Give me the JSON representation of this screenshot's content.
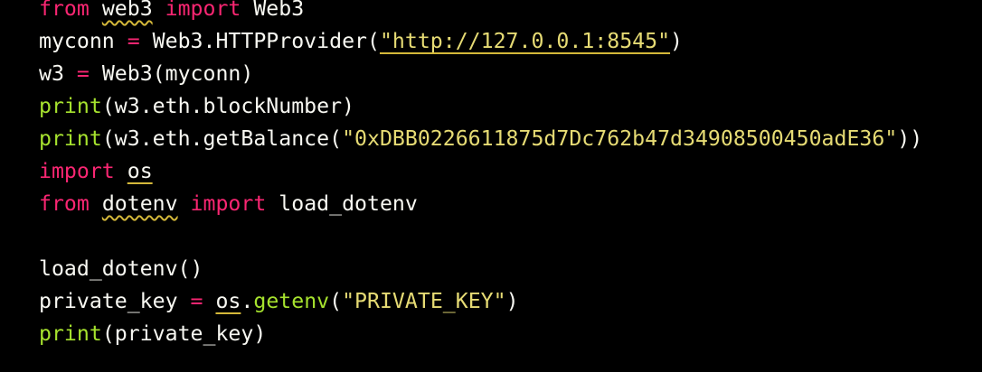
{
  "colors": {
    "background": "#000000",
    "default_text": "#f8f8f2",
    "keyword": "#f92672",
    "builtin_function": "#a6e22e",
    "string": "#e6db74",
    "lint_underline": "#d4b83a"
  },
  "code": {
    "lines": [
      {
        "tokens": [
          {
            "text": "from",
            "type": "keyword"
          },
          {
            "text": " ",
            "type": "plain"
          },
          {
            "text": "web3",
            "type": "plain",
            "underline": "wavy"
          },
          {
            "text": " ",
            "type": "plain"
          },
          {
            "text": "import",
            "type": "keyword"
          },
          {
            "text": " Web3",
            "type": "plain"
          }
        ]
      },
      {
        "tokens": [
          {
            "text": "myconn ",
            "type": "plain"
          },
          {
            "text": "=",
            "type": "keyword"
          },
          {
            "text": " Web3.HTTPProvider(",
            "type": "plain"
          },
          {
            "text": "\"http://127.0.0.1:8545\"",
            "type": "string",
            "underline": "solid"
          },
          {
            "text": ")",
            "type": "plain"
          }
        ]
      },
      {
        "tokens": [
          {
            "text": "w3 ",
            "type": "plain"
          },
          {
            "text": "=",
            "type": "keyword"
          },
          {
            "text": " Web3(myconn)",
            "type": "plain"
          }
        ]
      },
      {
        "tokens": [
          {
            "text": "print",
            "type": "builtin"
          },
          {
            "text": "(w3.eth.blockNumber)",
            "type": "plain"
          }
        ]
      },
      {
        "tokens": [
          {
            "text": "print",
            "type": "builtin"
          },
          {
            "text": "(w3.eth.getBalance(",
            "type": "plain"
          },
          {
            "text": "\"0xDBB0226611875d7Dc762b47d34908500450adE36\"",
            "type": "string"
          },
          {
            "text": "))",
            "type": "plain"
          }
        ]
      },
      {
        "tokens": [
          {
            "text": "import",
            "type": "keyword"
          },
          {
            "text": " ",
            "type": "plain"
          },
          {
            "text": "os",
            "type": "plain",
            "underline": "solid"
          }
        ]
      },
      {
        "tokens": [
          {
            "text": "from",
            "type": "keyword"
          },
          {
            "text": " ",
            "type": "plain"
          },
          {
            "text": "dotenv",
            "type": "plain",
            "underline": "wavy"
          },
          {
            "text": " ",
            "type": "plain"
          },
          {
            "text": "import",
            "type": "keyword"
          },
          {
            "text": " load_dotenv",
            "type": "plain"
          }
        ]
      },
      {
        "tokens": []
      },
      {
        "tokens": [
          {
            "text": "load_dotenv()",
            "type": "plain"
          }
        ]
      },
      {
        "tokens": [
          {
            "text": "private_key ",
            "type": "plain"
          },
          {
            "text": "=",
            "type": "keyword"
          },
          {
            "text": " ",
            "type": "plain"
          },
          {
            "text": "os",
            "type": "plain",
            "underline": "solid"
          },
          {
            "text": ".",
            "type": "plain"
          },
          {
            "text": "getenv",
            "type": "builtin"
          },
          {
            "text": "(",
            "type": "plain"
          },
          {
            "text": "\"PRIVATE_KEY\"",
            "type": "string"
          },
          {
            "text": ")",
            "type": "plain"
          }
        ]
      },
      {
        "tokens": [
          {
            "text": "print",
            "type": "builtin"
          },
          {
            "text": "(private_key)",
            "type": "plain"
          }
        ]
      }
    ]
  }
}
